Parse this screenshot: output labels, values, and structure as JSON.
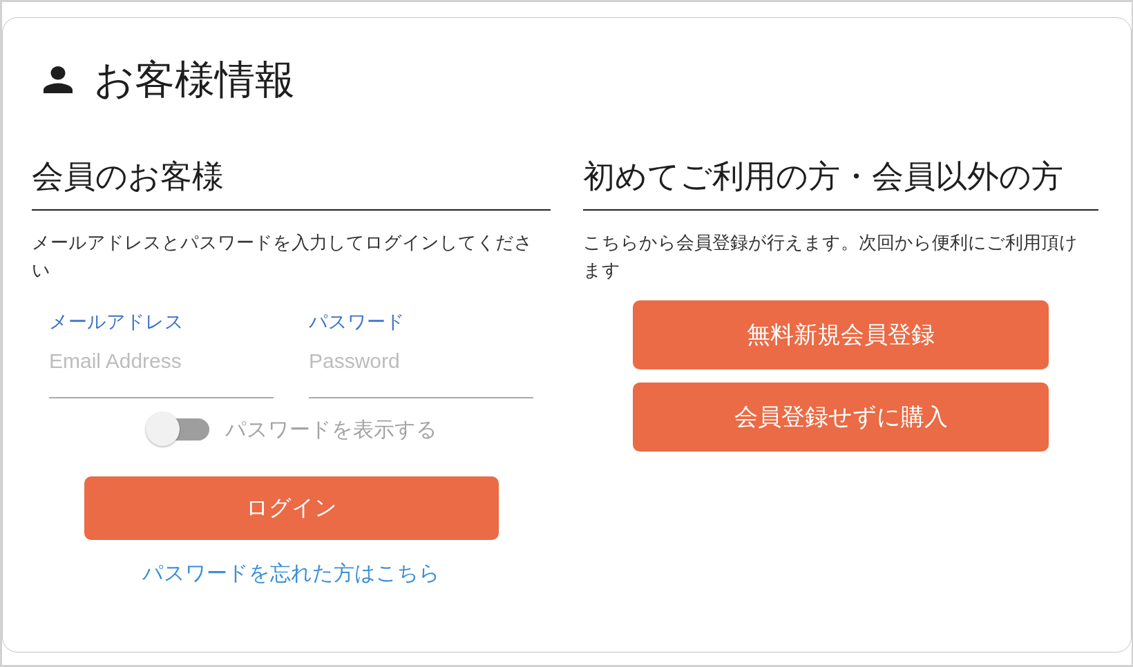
{
  "page_title": "お客様情報",
  "members": {
    "heading": "会員のお客様",
    "description": "メールアドレスとパスワードを入力してログインしてください",
    "fields": [
      {
        "label": "メールアドレス",
        "placeholder": "Email Address"
      },
      {
        "label": "パスワード",
        "placeholder": "Password"
      }
    ],
    "show_password": {
      "label": "パスワードを表示する",
      "on": false
    },
    "login_button": "ログイン",
    "forgot_password_link": "パスワードを忘れた方はこちら"
  },
  "guests": {
    "heading": "初めてご利用の方・会員以外の方",
    "description": "こちらから会員登録が行えます。次回から便利にご利用頂けます",
    "buttons": [
      "無料新規会員登録",
      "会員登録せずに購入"
    ]
  }
}
